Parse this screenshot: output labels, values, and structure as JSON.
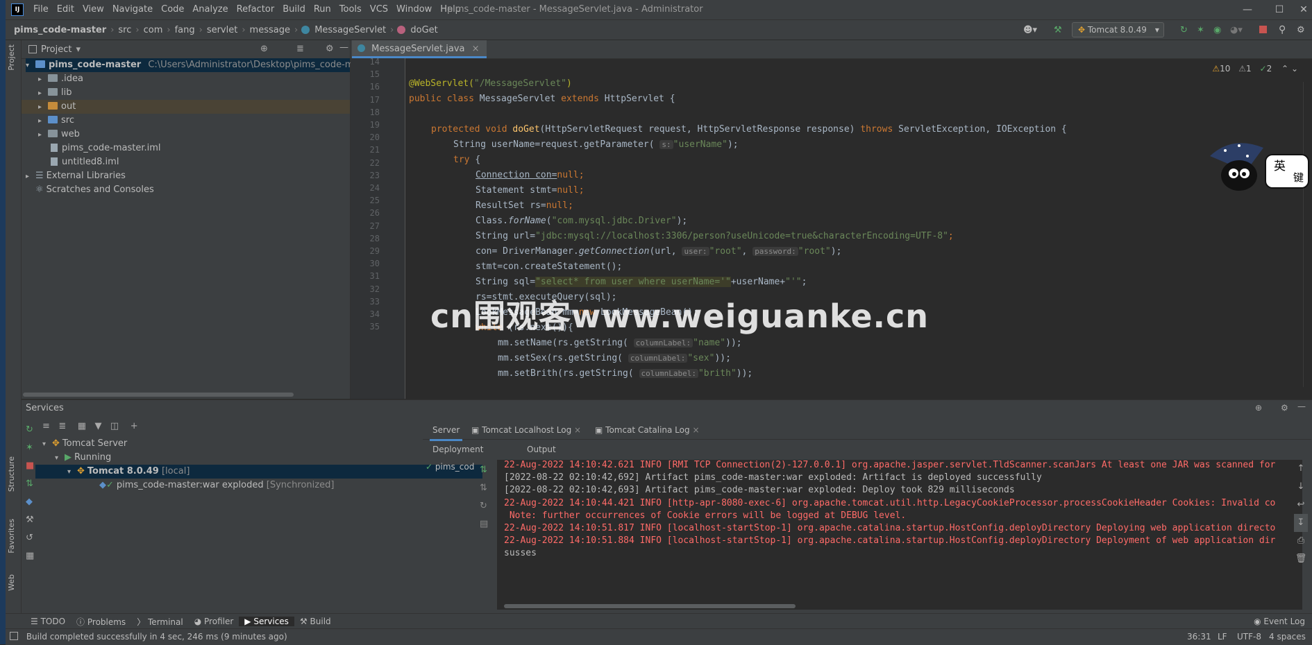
{
  "window": {
    "title": "pims_code-master - MessageServlet.java - Administrator",
    "menu": [
      "File",
      "Edit",
      "View",
      "Navigate",
      "Code",
      "Analyze",
      "Refactor",
      "Build",
      "Run",
      "Tools",
      "VCS",
      "Window",
      "Help"
    ],
    "run_config": "Tomcat 8.0.49"
  },
  "breadcrumbs": [
    "pims_code-master",
    "src",
    "com",
    "fang",
    "servlet",
    "message",
    "MessageServlet",
    "doGet"
  ],
  "project_panel": {
    "title": "Project",
    "root_name": "pims_code-master",
    "root_path": "C:\\Users\\Administrator\\Desktop\\pims_code-master\\pi",
    "items": [
      ".idea",
      "lib",
      "out",
      "src",
      "web",
      "pims_code-master.iml",
      "untitled8.iml",
      "External Libraries",
      "Scratches and Consoles"
    ]
  },
  "side_tabs": {
    "project": "Project",
    "structure": "Structure",
    "favorites": "Favorites",
    "web": "Web"
  },
  "editor": {
    "tab": "MessageServlet.java",
    "inspection": {
      "warnings": "10",
      "weak": "1",
      "ok": "2"
    },
    "line_numbers": [
      "14",
      "15",
      "16",
      "17",
      "18",
      "19",
      "20",
      "21",
      "22",
      "23",
      "24",
      "25",
      "26",
      "27",
      "28",
      "29",
      "30",
      "31",
      "32",
      "33",
      "34",
      "35"
    ]
  },
  "code_lines": {
    "l16a": "@WebServlet(",
    "l16b": "\"/MessageServlet\"",
    "l16c": ")",
    "l17a": "public class ",
    "l17b": "MessageServlet ",
    "l17c": "extends ",
    "l17d": "HttpServlet {",
    "l19a": "protected void ",
    "l19b": "doGet",
    "l19c": "(HttpServletRequest request, HttpServletResponse response) ",
    "l19d": "throws ",
    "l19e": "ServletException, IOException {",
    "l20a": "String userName=request.getParameter( ",
    "l20hint": "s:",
    "l20b": "\"userName\"",
    "l20c": ");",
    "l21a": "try ",
    "l21b": "{",
    "l22a": "Connection con=",
    "l22b": "null",
    "l22c": ";",
    "l23a": "Statement stmt=",
    "l23b": "null",
    "l23c": ";",
    "l24a": "ResultSet rs=",
    "l24b": "null",
    "l24c": ";",
    "l25a": "Class.",
    "l25b": "forName",
    "l25c": "(",
    "l25d": "\"com.mysql.jdbc.Driver\"",
    "l25e": ");",
    "l26a": "String url=",
    "l26b": "\"jdbc:mysql://localhost:3306/person?useUnicode=true&characterEncoding=UTF-8\"",
    "l26c": ";",
    "l27a": "con= DriverManager.",
    "l27b": "getConnection",
    "l27c": "(url, ",
    "l27hint1": "user:",
    "l27d": "\"root\"",
    "l27e": ", ",
    "l27hint2": "password:",
    "l27f": "\"root\"",
    "l27g": ");",
    "l28": "stmt=con.createStatement();",
    "l29a": "String sql=",
    "l29b": "\"select* from user where userName='\"",
    "l29c": "+userName+",
    "l29d": "\"'\"",
    "l29e": ";",
    "l30": "rs=stmt.executeQuery(sql);",
    "l31a": "LookMessageBean mm=",
    "l31b": "new ",
    "l31c": "LookMessageBean();",
    "l32a": "while ",
    "l32b": "(rs.next()){",
    "l33a": "mm.setName(rs.getString( ",
    "l33hint": "columnLabel:",
    "l33b": "\"name\"",
    "l33c": "));",
    "l34a": "mm.setSex(rs.getString( ",
    "l34hint": "columnLabel:",
    "l34b": "\"sex\"",
    "l34c": "));",
    "l35a": "mm.setBrith(rs.getString( ",
    "l35hint": "columnLabel:",
    "l35b": "\"brith\"",
    "l35c": "));"
  },
  "watermark": "cn围观客www.weiguanke.cn",
  "mascot_text": [
    "英",
    "键"
  ],
  "services": {
    "title": "Services",
    "tree": {
      "server": "Tomcat Server",
      "status": "Running",
      "instance": "Tomcat 8.0.49",
      "instance_tag": "[local]",
      "artifact": "pims_code-master:war exploded",
      "artifact_tag": "[Synchronized]"
    },
    "tabs": [
      "Server",
      "Tomcat Localhost Log",
      "Tomcat Catalina Log"
    ],
    "deployment_label": "Deployment",
    "output_label": "Output",
    "deployment_item": "pims_cod",
    "log": [
      {
        "text": "22-Aug-2022 14:10:42.621 INFO [RMI TCP Connection(2)-127.0.0.1] org.apache.jasper.servlet.TldScanner.scanJars At least one JAR was scanned for",
        "color": "#ff6b68"
      },
      {
        "text": "[2022-08-22 02:10:42,692] Artifact pims_code-master:war exploded: Artifact is deployed successfully",
        "color": "#bbbbbb"
      },
      {
        "text": "[2022-08-22 02:10:42,693] Artifact pims_code-master:war exploded: Deploy took 829 milliseconds",
        "color": "#bbbbbb"
      },
      {
        "text": "22-Aug-2022 14:10:44.421 INFO [http-apr-8080-exec-6] org.apache.tomcat.util.http.LegacyCookieProcessor.processCookieHeader Cookies: Invalid co",
        "color": "#ff6b68"
      },
      {
        "text": " Note: further occurrences of Cookie errors will be logged at DEBUG level.",
        "color": "#ff6b68"
      },
      {
        "text": "22-Aug-2022 14:10:51.817 INFO [localhost-startStop-1] org.apache.catalina.startup.HostConfig.deployDirectory Deploying web application directo",
        "color": "#ff6b68"
      },
      {
        "text": "22-Aug-2022 14:10:51.884 INFO [localhost-startStop-1] org.apache.catalina.startup.HostConfig.deployDirectory Deployment of web application dir",
        "color": "#ff6b68"
      },
      {
        "text": "susses",
        "color": "#bbbbbb"
      }
    ]
  },
  "bottom_tabs": [
    "TODO",
    "Problems",
    "Terminal",
    "Profiler",
    "Services",
    "Build"
  ],
  "event_log": "Event Log",
  "status": {
    "message": "Build completed successfully in 4 sec, 246 ms (9 minutes ago)",
    "position": "36:31",
    "line_sep": "LF",
    "encoding": "UTF-8",
    "indent": "4 spaces"
  }
}
